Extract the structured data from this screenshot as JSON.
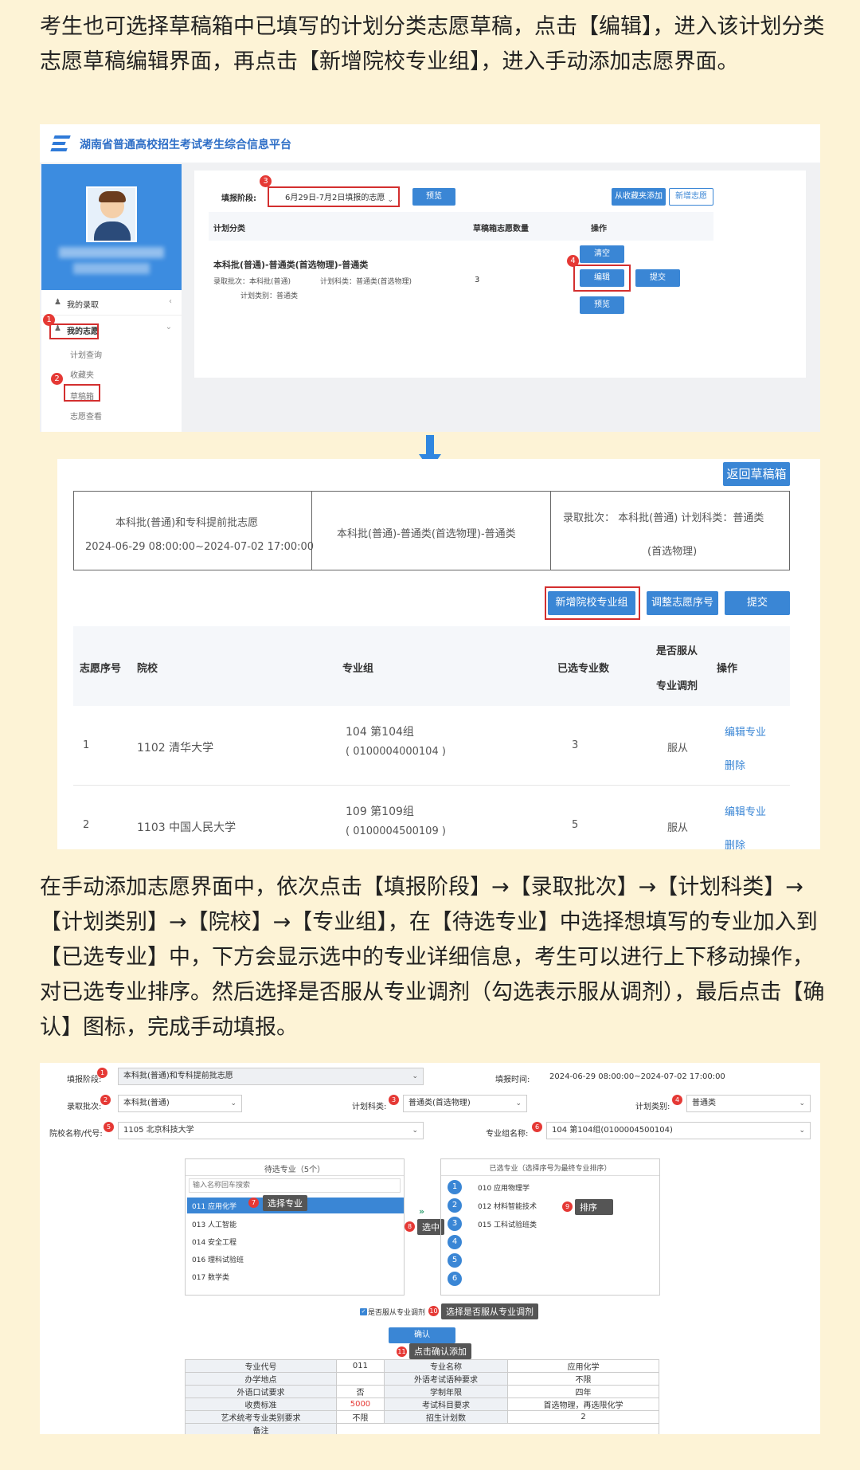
{
  "intro_text": "考生也可选择草稿箱中已填写的计划分类志愿草稿，点击【编辑】，进入该计划分类志愿草稿编辑界面，再点击【新增院校专业组】，进入手动添加志愿界面。",
  "second_text": "在手动添加志愿界面中，依次点击【填报阶段】→【录取批次】→【计划科类】→【计划类别】→【院校】→【专业组】，在【待选专业】中选择想填写的专业加入到【已选专业】中，下方会显示选中的专业详细信息，考生可以进行上下移动操作，对已选专业排序。然后选择是否服从专业调剂（勾选表示服从调剂），最后点击【确认】图标，完成手动填报。",
  "colors": {
    "accent": "#3a86d5",
    "marker": "#e53935",
    "page_bg": "#fdf3d6"
  },
  "shot1": {
    "platform_title": "湖南省普通高校招生考试考生综合信息平台",
    "logo_icon": "platform-logo-icon",
    "menu": {
      "my_admission": "我的录取",
      "my_wish": "我的志愿",
      "plan_query": "计划查询",
      "favorites": "收藏夹",
      "drafts": "草稿箱",
      "view_wish": "志愿查看"
    },
    "fill_stage_label": "填报阶段:",
    "fill_stage_value": "6月29日-7月2日填报的志愿",
    "preview_btn": "预览",
    "add_from_fav_btn": "从收藏夹添加",
    "new_wish_btn": "新增志愿",
    "col_plan": "计划分类",
    "col_count": "草稿箱志愿数量",
    "col_ops": "操作",
    "row_title": "本科批(普通)-普通类(首选物理)-普通类",
    "row_batch": "录取批次：本科批(普通)",
    "row_subject": "计划科类：普通类(首选物理)",
    "row_category": "计划类别：普通类",
    "row_count": "3",
    "clear_btn": "清空",
    "edit_btn": "编辑",
    "submit_btn": "提交",
    "preview2_btn": "预览",
    "markers": [
      "1",
      "2",
      "3",
      "4"
    ]
  },
  "shot2": {
    "back_btn": "返回草稿箱",
    "cell1_title": "本科批(普通)和专科提前批志愿",
    "cell1_time": "2024-06-29 08:00:00~2024-07-02 17:00:00",
    "cell2": "本科批(普通)-普通类(首选物理)-普通类",
    "cell3_line1": "录取批次： 本科批(普通) 计划科类：普通类",
    "cell3_line2": "(首选物理)",
    "new_group_btn": "新增院校专业组",
    "adjust_btn": "调整志愿序号",
    "submit_btn": "提交",
    "headers": {
      "seq": "志愿序号",
      "school": "院校",
      "group": "专业组",
      "selected": "已选专业数",
      "obey1": "是否服从",
      "obey2": "专业调剂",
      "ops": "操作"
    },
    "rows": [
      {
        "seq": "1",
        "school": "1102 清华大学",
        "group": "104 第104组",
        "group_code": "( 0100004000104 )",
        "count": "3",
        "obey": "服从",
        "edit": "编辑专业",
        "del": "删除"
      },
      {
        "seq": "2",
        "school": "1103 中国人民大学",
        "group": "109 第109组",
        "group_code": "( 0100004500109 )",
        "count": "5",
        "obey": "服从",
        "edit": "编辑专业",
        "del": "删除"
      }
    ]
  },
  "shot3": {
    "fill_stage_label": "填报阶段:",
    "fill_stage_value": "本科批(普通)和专科提前批志愿",
    "fill_time_label": "填报时间:",
    "fill_time_value": "2024-06-29 08:00:00~2024-07-02 17:00:00",
    "batch_label": "录取批次:",
    "batch_value": "本科批(普通)",
    "subject_label": "计划科类:",
    "subject_value": "普通类(首选物理)",
    "category_label": "计划类别:",
    "category_value": "普通类",
    "school_label": "院校名称/代号:",
    "school_value": "1105 北京科技大学",
    "group_label": "专业组名称:",
    "group_value": "104 第104组(0100004500104)",
    "pending_title": "待选专业（5个）",
    "search_placeholder": "输入名称回车搜索",
    "pending": [
      "011 应用化学",
      "013 人工智能",
      "014 安全工程",
      "016 理科试验班",
      "017 数学类"
    ],
    "chosen_title": "已选专业（选择序号为最终专业排序）",
    "chosen": [
      "010 应用物理学",
      "012 材料智能技术",
      "015 工科试验班类"
    ],
    "slots": [
      "1",
      "2",
      "3",
      "4",
      "5",
      "6"
    ],
    "tip_select_major": "选择专业",
    "tip_pick": "选中",
    "tip_sort": "排序",
    "obey_label": "是否服从专业调剂",
    "tip_obey": "选择是否服从专业调剂",
    "confirm_btn": "确认",
    "tip_confirm": "点击确认添加",
    "markers": [
      "1",
      "2",
      "3",
      "4",
      "5",
      "6",
      "7",
      "8",
      "9",
      "10",
      "11"
    ],
    "info": [
      [
        "专业代号",
        "011",
        "专业名称",
        "应用化学"
      ],
      [
        "办学地点",
        "",
        "外语考试语种要求",
        "不限"
      ],
      [
        "外语口试要求",
        "否",
        "学制年限",
        "四年"
      ],
      [
        "收费标准",
        "5000",
        "考试科目要求",
        "首选物理，再选限化学"
      ],
      [
        "艺术统考专业类别要求",
        "不限",
        "招生计划数",
        "2"
      ],
      [
        "备注",
        "",
        "",
        ""
      ]
    ]
  }
}
